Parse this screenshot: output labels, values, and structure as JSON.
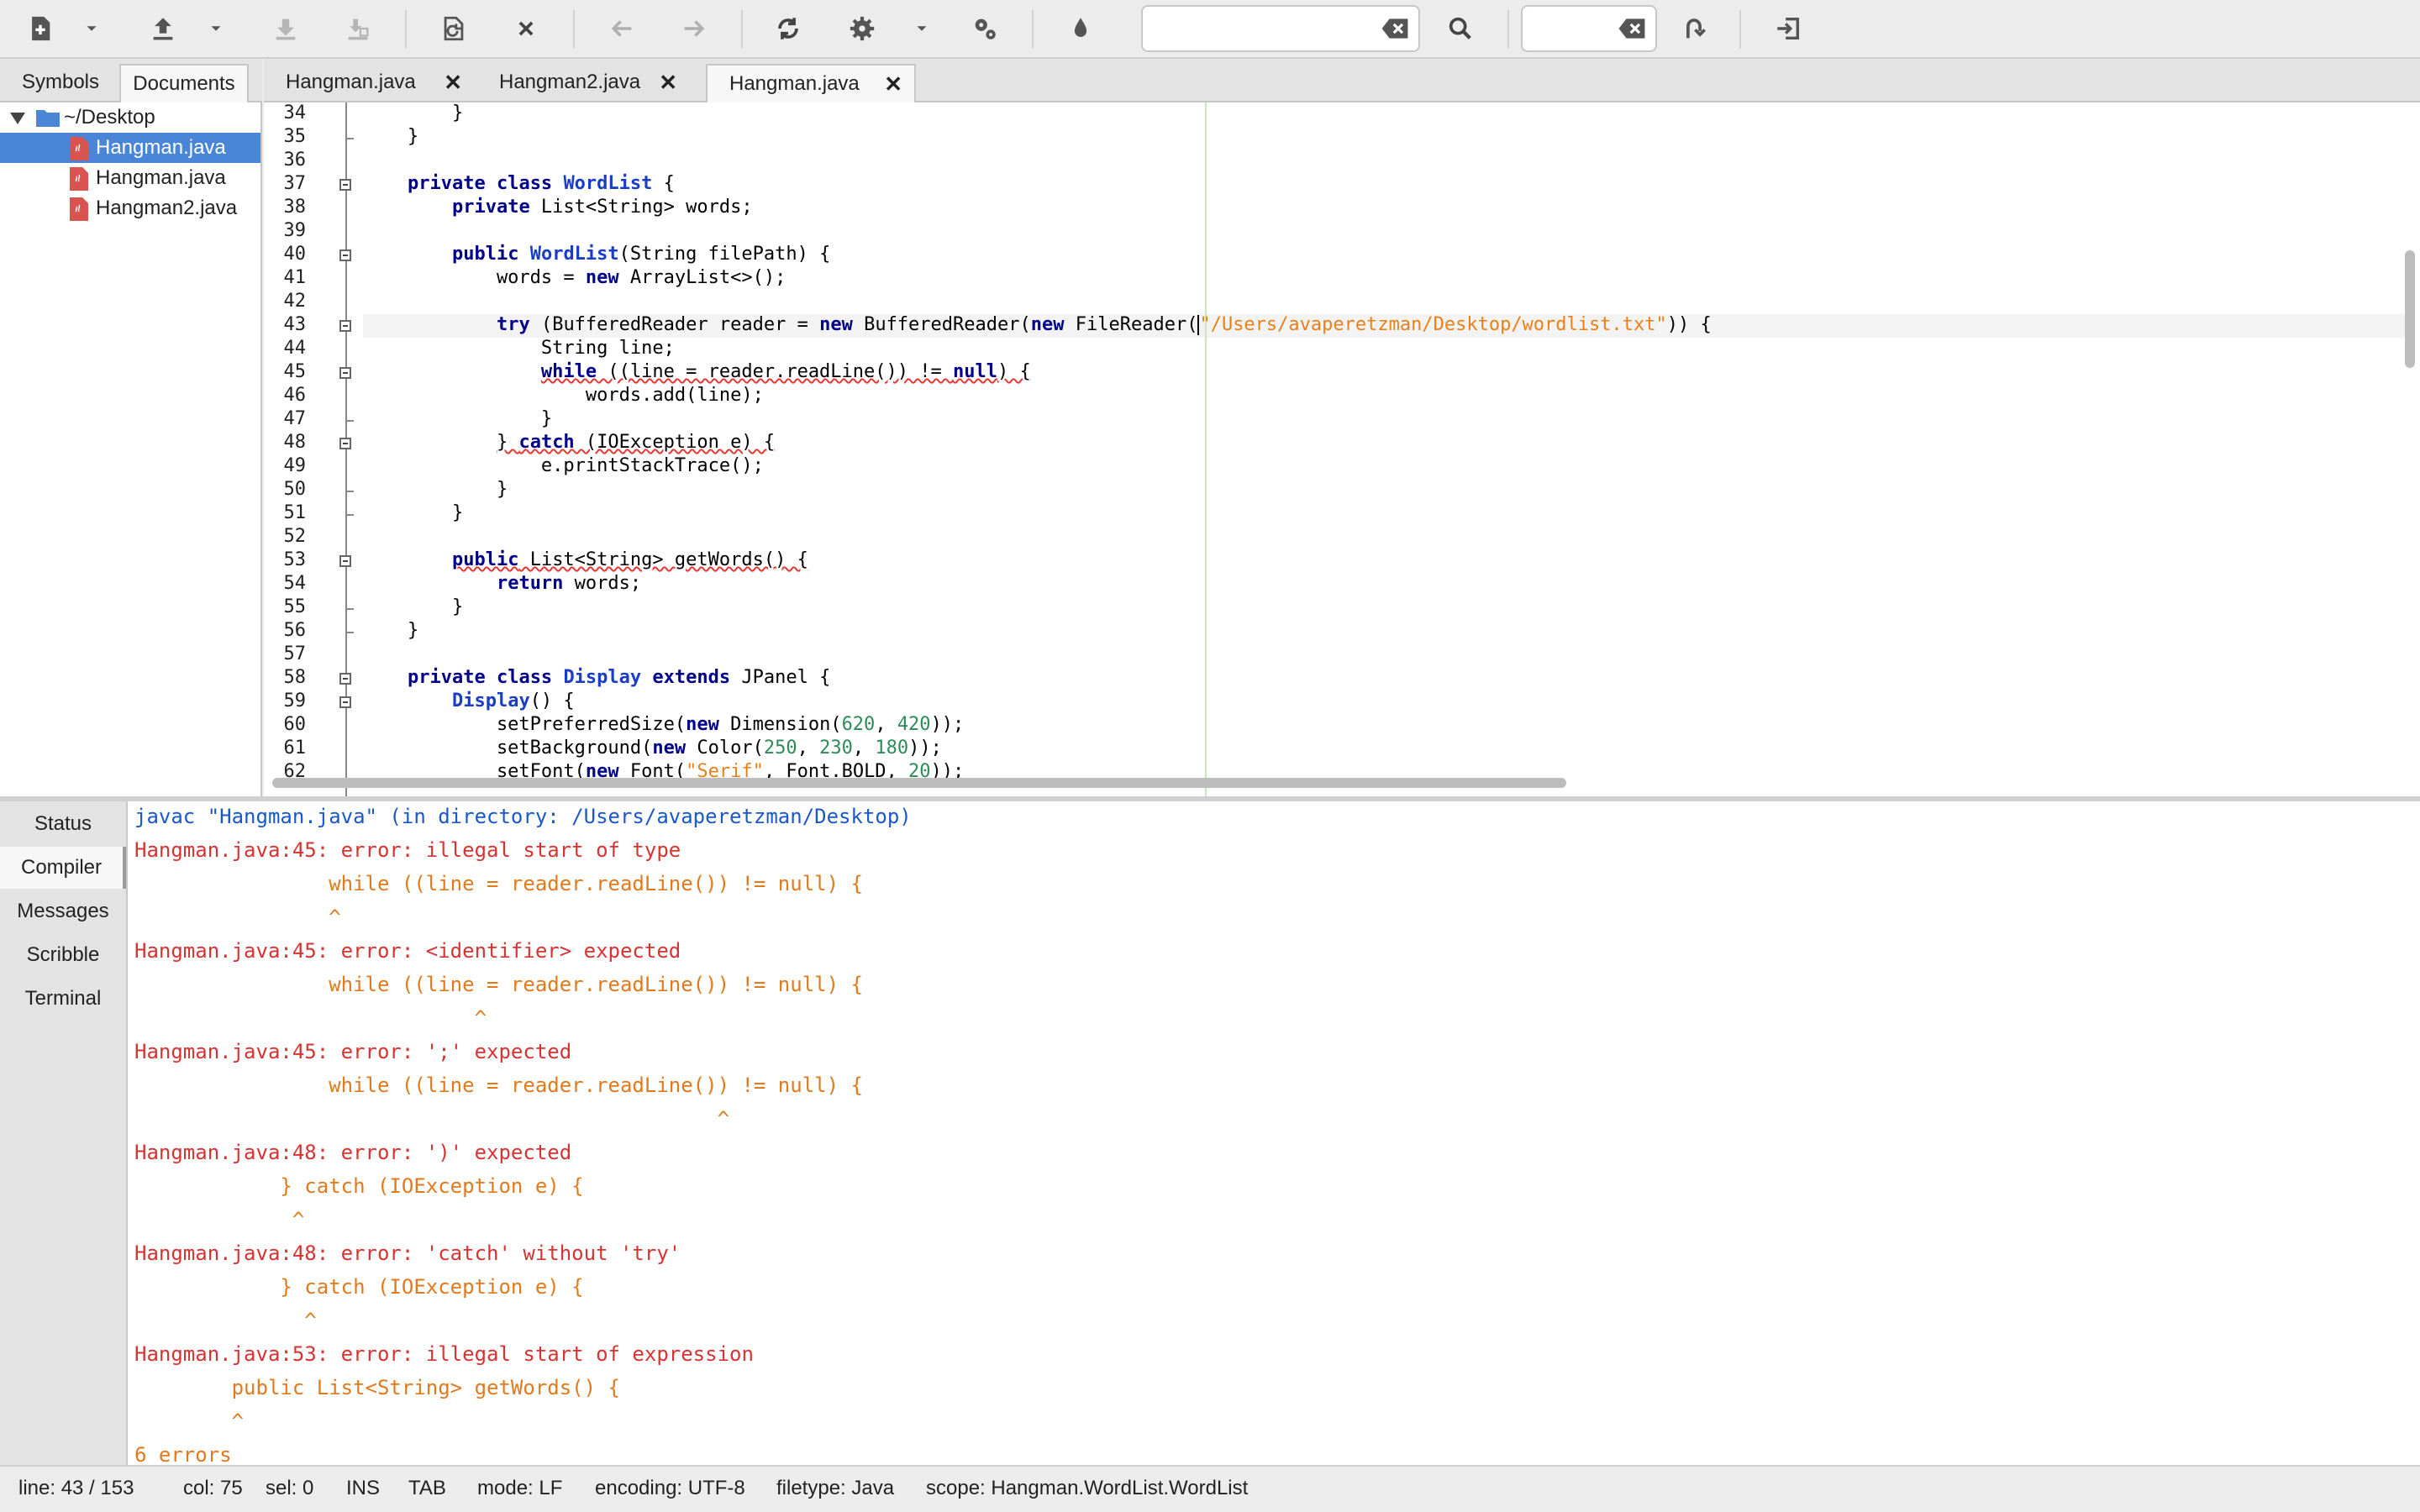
{
  "toolbar": {
    "buttons": [
      {
        "name": "new-file-icon"
      },
      {
        "name": "new-from-template-icon"
      },
      {
        "name": "open-file-icon"
      },
      {
        "name": "open-recent-icon"
      },
      {
        "name": "save-icon"
      },
      {
        "name": "save-all-icon"
      },
      {
        "name": "revert-icon"
      },
      {
        "name": "close-icon"
      },
      {
        "name": "navigate-back-icon"
      },
      {
        "name": "navigate-forward-icon"
      },
      {
        "name": "compile-icon"
      },
      {
        "name": "build-icon"
      },
      {
        "name": "build-options-icon"
      },
      {
        "name": "run-icon"
      },
      {
        "name": "color-chooser-icon"
      },
      {
        "name": "search-icon"
      },
      {
        "name": "goto-line-icon"
      },
      {
        "name": "quit-icon"
      }
    ],
    "search_value": "",
    "goto_value": ""
  },
  "sidebar": {
    "tabs": [
      "Symbols",
      "Documents"
    ],
    "active_tab": "Documents",
    "tree": {
      "folder": "~/Desktop",
      "files": [
        "Hangman.java",
        "Hangman.java",
        "Hangman2.java"
      ],
      "selected_index": 0
    }
  },
  "editor_tabs": [
    {
      "label": "Hangman.java",
      "close": "✕"
    },
    {
      "label": "Hangman2.java",
      "close": "✕"
    },
    {
      "label": "Hangman.java",
      "close": "✕"
    }
  ],
  "editor": {
    "lines": [
      {
        "n": "34",
        "html": "        }"
      },
      {
        "n": "35",
        "html": "    }"
      },
      {
        "n": "36",
        "html": ""
      },
      {
        "n": "37",
        "html": "    <span class='kw'>private</span> <span class='kw'>class</span> <span class='cn'>WordList</span> {"
      },
      {
        "n": "38",
        "html": "        <span class='kw'>private</span> List&lt;String&gt; words;"
      },
      {
        "n": "39",
        "html": ""
      },
      {
        "n": "40",
        "html": "        <span class='kw'>public</span> <span class='cn'>WordList</span>(String filePath) {"
      },
      {
        "n": "41",
        "html": "            words = <span class='kw'>new</span> ArrayList&lt;&gt;();"
      },
      {
        "n": "42",
        "html": ""
      },
      {
        "n": "43",
        "html": "            <span class='kw'>try</span> (BufferedReader reader = <span class='kw'>new</span> BufferedReader(<span class='kw'>new</span> FileReader(<span class='caret'></span><span class='str'>\"/Users/avaperetzman/Desktop/wordlist.txt\"</span>)) {"
      },
      {
        "n": "44",
        "html": "                String line;"
      },
      {
        "n": "45",
        "html": "                <span class='squig'><span class='kw'>while</span> ((line = reader.readLine()) != <span class='kw'>null</span>) {</span>"
      },
      {
        "n": "46",
        "html": "                    words.add(line);"
      },
      {
        "n": "47",
        "html": "                }"
      },
      {
        "n": "48",
        "html": "            <span class='squig'>} <span class='kw'>catch</span> (IOException e) {</span>"
      },
      {
        "n": "49",
        "html": "                e.printStackTrace();"
      },
      {
        "n": "50",
        "html": "            }"
      },
      {
        "n": "51",
        "html": "        }"
      },
      {
        "n": "52",
        "html": ""
      },
      {
        "n": "53",
        "html": "        <span class='squig'><span class='kw'>public</span> List&lt;String&gt; getWords() {</span>"
      },
      {
        "n": "54",
        "html": "            <span class='kw'>return</span> words;"
      },
      {
        "n": "55",
        "html": "        }"
      },
      {
        "n": "56",
        "html": "    }"
      },
      {
        "n": "57",
        "html": ""
      },
      {
        "n": "58",
        "html": "    <span class='kw'>private</span> <span class='kw'>class</span> <span class='cn'>Display</span> <span class='kw'>extends</span> JPanel {"
      },
      {
        "n": "59",
        "html": "        <span class='cn'>Display</span>() {"
      },
      {
        "n": "60",
        "html": "            setPreferredSize(<span class='kw'>new</span> Dimension(<span class='num'>620</span>, <span class='num'>420</span>));"
      },
      {
        "n": "61",
        "html": "            setBackground(<span class='kw'>new</span> Color(<span class='num'>250</span>, <span class='num'>230</span>, <span class='num'>180</span>));"
      },
      {
        "n": "62",
        "html": "            setFont(<span class='kw'>new</span> Font(<span class='str'>\"Serif\"</span>, Font.BOLD, <span class='num'>20</span>));"
      }
    ]
  },
  "messages": {
    "tabs": [
      "Status",
      "Compiler",
      "Messages",
      "Scribble",
      "Terminal"
    ],
    "active_tab": "Compiler",
    "compiler_lines": [
      {
        "cls": "c-blue",
        "text": "javac \"Hangman.java\" (in directory: /Users/avaperetzman/Desktop)"
      },
      {
        "cls": "c-red",
        "text": "Hangman.java:45: error: illegal start of type"
      },
      {
        "cls": "c-orange",
        "text": "                while ((line = reader.readLine()) != null) {"
      },
      {
        "cls": "c-orange",
        "text": "                ^"
      },
      {
        "cls": "c-red",
        "text": "Hangman.java:45: error: <identifier> expected"
      },
      {
        "cls": "c-orange",
        "text": "                while ((line = reader.readLine()) != null) {"
      },
      {
        "cls": "c-orange",
        "text": "                            ^"
      },
      {
        "cls": "c-red",
        "text": "Hangman.java:45: error: ';' expected"
      },
      {
        "cls": "c-orange",
        "text": "                while ((line = reader.readLine()) != null) {"
      },
      {
        "cls": "c-orange",
        "text": "                                                ^"
      },
      {
        "cls": "c-red",
        "text": "Hangman.java:48: error: ')' expected"
      },
      {
        "cls": "c-orange",
        "text": "            } catch (IOException e) {"
      },
      {
        "cls": "c-orange",
        "text": "             ^"
      },
      {
        "cls": "c-red",
        "text": "Hangman.java:48: error: 'catch' without 'try'"
      },
      {
        "cls": "c-orange",
        "text": "            } catch (IOException e) {"
      },
      {
        "cls": "c-orange",
        "text": "              ^"
      },
      {
        "cls": "c-red",
        "text": "Hangman.java:53: error: illegal start of expression"
      },
      {
        "cls": "c-orange",
        "text": "        public List<String> getWords() {"
      },
      {
        "cls": "c-orange",
        "text": "        ^"
      },
      {
        "cls": "c-orange",
        "text": "6 errors"
      }
    ]
  },
  "statusbar": {
    "line": "line: 43 / 153",
    "col": "col: 75",
    "sel": "sel: 0",
    "ins": "INS",
    "tab": "TAB",
    "mode": "mode: LF",
    "encoding": "encoding: UTF-8",
    "filetype": "filetype: Java",
    "scope": "scope: Hangman.WordList.WordList"
  },
  "colors": {
    "selection": "#4a86d8",
    "keyword": "#00008b",
    "string": "#e8801a",
    "number": "#2e8b57",
    "error": "#d63333",
    "info": "#1a58c8"
  }
}
